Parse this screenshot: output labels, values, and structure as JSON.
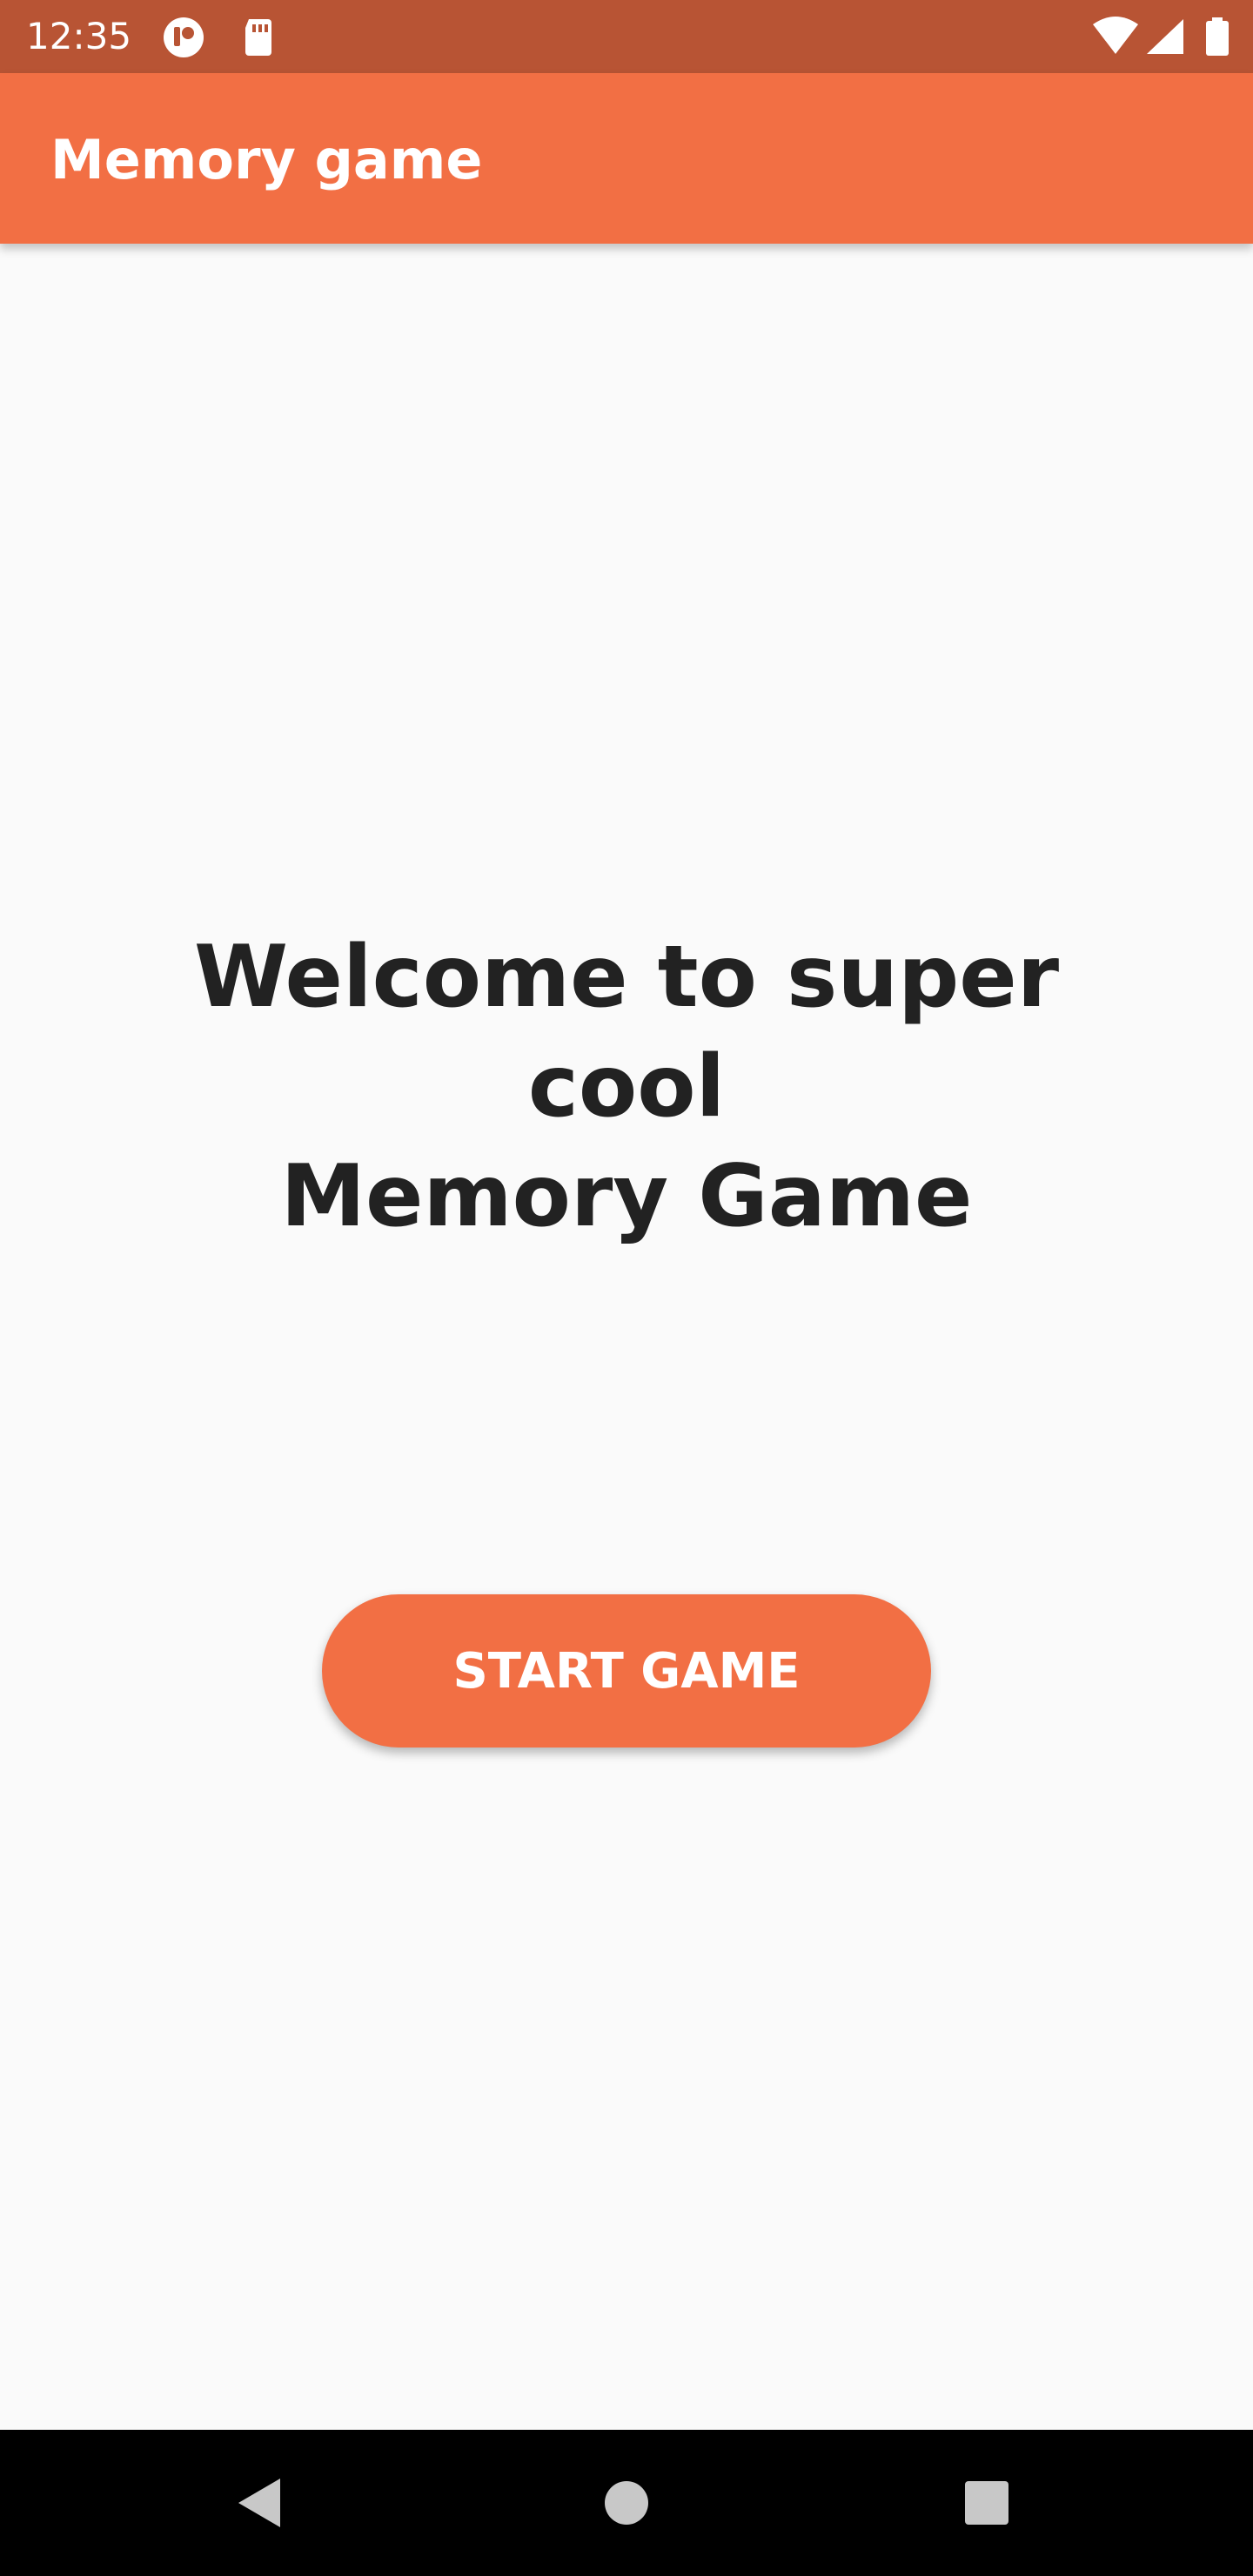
{
  "status_bar": {
    "time": "12:35",
    "left_icons": [
      "app-notification-icon",
      "sd-card-icon"
    ],
    "right_icons": [
      "wifi-icon",
      "cellular-signal-icon",
      "battery-icon"
    ]
  },
  "app_bar": {
    "title": "Memory game"
  },
  "main": {
    "welcome_line1": "Welcome to super cool",
    "welcome_line2": "Memory Game",
    "start_button_label": "START GAME"
  },
  "nav_bar": {
    "buttons": [
      "back-icon",
      "home-icon",
      "recents-icon"
    ]
  },
  "colors": {
    "primary": "#f26f44",
    "status_bar": "#b85434",
    "background": "#fafafa",
    "text": "#222222"
  }
}
